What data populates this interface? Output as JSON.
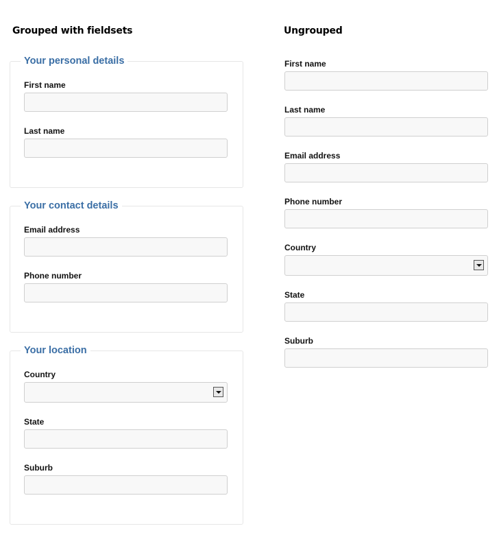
{
  "grouped": {
    "title": "Grouped with fieldsets",
    "fieldsets": [
      {
        "legend": "Your personal details",
        "fields": [
          {
            "label": "First name",
            "value": "",
            "placeholder": ""
          },
          {
            "label": "Last name",
            "value": "",
            "placeholder": ""
          }
        ]
      },
      {
        "legend": "Your contact details",
        "fields": [
          {
            "label": "Email address",
            "value": "",
            "placeholder": ""
          },
          {
            "label": "Phone number",
            "value": "",
            "placeholder": ""
          }
        ]
      },
      {
        "legend": "Your location",
        "fields": [
          {
            "label": "Country",
            "selected": "",
            "type": "select"
          },
          {
            "label": "State",
            "value": "",
            "placeholder": ""
          },
          {
            "label": "Suburb",
            "value": "",
            "placeholder": ""
          }
        ]
      }
    ]
  },
  "ungrouped": {
    "title": "Ungrouped",
    "fields": [
      {
        "label": "First name",
        "value": "",
        "placeholder": ""
      },
      {
        "label": "Last name",
        "value": "",
        "placeholder": ""
      },
      {
        "label": "Email address",
        "value": "",
        "placeholder": ""
      },
      {
        "label": "Phone number",
        "value": "",
        "placeholder": ""
      },
      {
        "label": "Country",
        "selected": "",
        "type": "select"
      },
      {
        "label": "State",
        "value": "",
        "placeholder": ""
      },
      {
        "label": "Suburb",
        "value": "",
        "placeholder": ""
      }
    ]
  },
  "colors": {
    "legend": "#3a6ea5",
    "input_bg": "#f8f8f8",
    "input_border": "#cfcfcf",
    "fieldset_border": "#e6e6e6"
  },
  "icons": {
    "select_arrow": "chevron-down-icon"
  }
}
